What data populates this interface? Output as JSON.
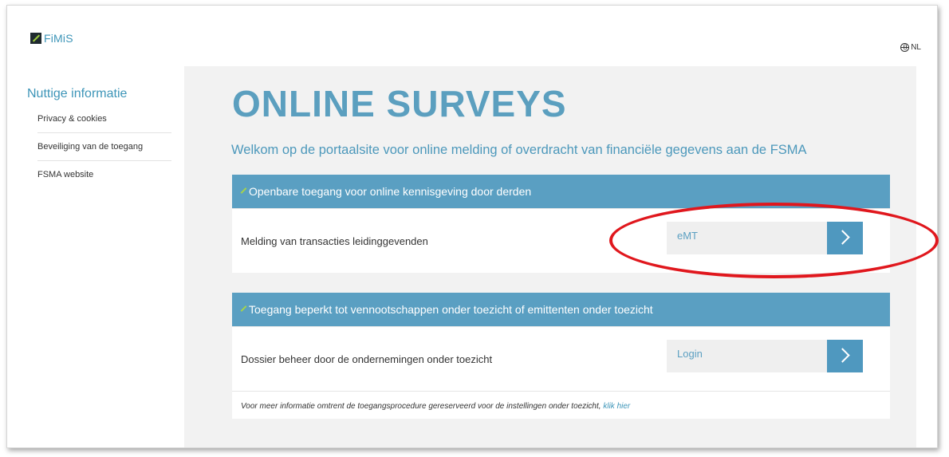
{
  "brand": {
    "name": "FiMiS",
    "accent": "#3d95b8",
    "mark_color": "#9ccc3c"
  },
  "language": {
    "icon": "globe-icon",
    "label": "NL"
  },
  "sidebar": {
    "title": "Nuttige informatie",
    "items": [
      {
        "label": "Privacy & cookies"
      },
      {
        "label": "Beveiliging van de toegang"
      },
      {
        "label": "FSMA website"
      }
    ]
  },
  "main": {
    "title": "ONLINE SURVEYS",
    "subtitle": "Welkom op de portaalsite voor online melding of overdracht van financiële gegevens aan de FSMA",
    "sections": [
      {
        "header": "Openbare toegang voor online kennisgeving door derden",
        "row": {
          "label": "Melding van transacties leidinggevenden",
          "action_label": "eMT",
          "action_icon": "chevron-right-icon"
        }
      },
      {
        "header": "Toegang beperkt tot vennootschappen onder toezicht of emittenten onder toezicht",
        "row": {
          "label": "Dossier beheer door de ondernemingen onder toezicht",
          "action_label": "Login",
          "action_icon": "chevron-right-icon"
        }
      }
    ],
    "note": {
      "text": "Voor meer informatie omtrent de toegangsprocedure gereserveerd voor de instellingen onder toezicht, ",
      "link": "klik hier"
    }
  },
  "colors": {
    "header_bg": "#5a9fc2",
    "button_bg": "#4f98bf",
    "highlight": "#e0171d"
  }
}
